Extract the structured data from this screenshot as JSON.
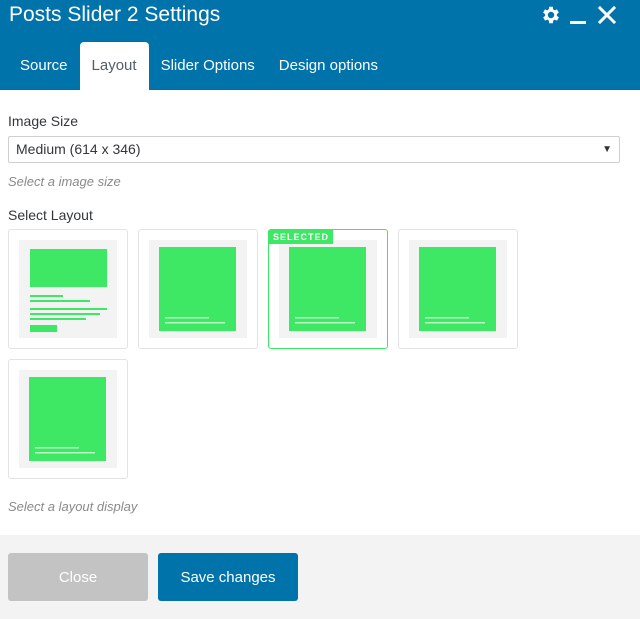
{
  "dialog": {
    "title": "Posts Slider 2 Settings"
  },
  "header_icons": [
    "gear-icon",
    "minimize-icon",
    "close-icon"
  ],
  "tabs": [
    {
      "label": "Source",
      "active": false
    },
    {
      "label": "Layout",
      "active": true
    },
    {
      "label": "Slider Options",
      "active": false
    },
    {
      "label": "Design options",
      "active": false
    }
  ],
  "image_size": {
    "label": "Image Size",
    "selected": "Medium (614 x 346)",
    "hint": "Select a image size"
  },
  "layout": {
    "label": "Select Layout",
    "selected_badge": "SELECTED",
    "selected_index": 2,
    "hint": "Select a layout display"
  },
  "footer": {
    "close_label": "Close",
    "save_label": "Save changes"
  },
  "colors": {
    "brand": "#0073aa",
    "accent_green": "#3ee864",
    "close_button": "#c3c3c3"
  }
}
